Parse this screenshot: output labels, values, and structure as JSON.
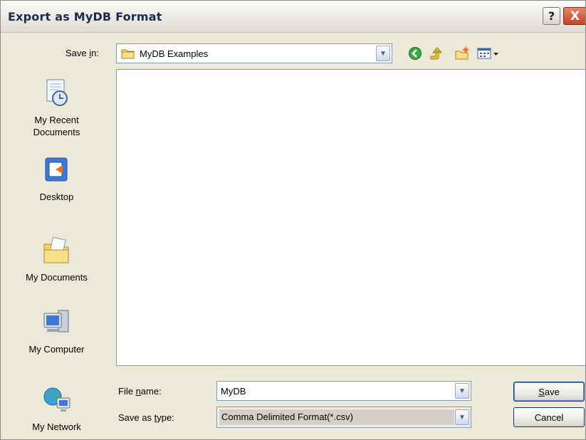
{
  "dialog": {
    "title": "Export as MyDB Format",
    "help_label": "?",
    "close_label": "X"
  },
  "save_in": {
    "label_prefix": "Save ",
    "label_accel": "i",
    "label_suffix": "n:",
    "value": "MyDB Examples"
  },
  "places": [
    {
      "label_1": "My Recent",
      "label_2": "Documents",
      "icon": "recent-documents-icon"
    },
    {
      "label_1": "Desktop",
      "label_2": "",
      "icon": "desktop-icon"
    },
    {
      "label_1": "My Documents",
      "label_2": "",
      "icon": "my-documents-icon"
    },
    {
      "label_1": "My Computer",
      "label_2": "",
      "icon": "my-computer-icon"
    },
    {
      "label_1": "My Network",
      "label_2": "",
      "icon": "my-network-icon"
    }
  ],
  "file_name": {
    "label_prefix": "File ",
    "label_accel": "n",
    "label_suffix": "ame:",
    "value": "MyDB"
  },
  "save_as_type": {
    "label_prefix": "Save as ",
    "label_accel": "t",
    "label_suffix": "ype:",
    "value": "Comma Delimited Format(*.csv)"
  },
  "buttons": {
    "save_accel": "S",
    "save_rest": "ave",
    "cancel": "Cancel"
  }
}
